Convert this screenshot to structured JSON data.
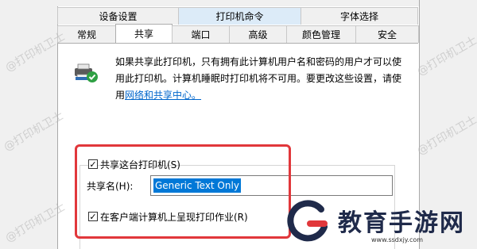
{
  "tabs_row1": [
    "设备设置",
    "打印机命令",
    "字体选择"
  ],
  "tabs_row2": [
    "常规",
    "共享",
    "端口",
    "高级",
    "颜色管理",
    "安全"
  ],
  "active_tab": "共享",
  "description": {
    "line1": "如果共享此打印机，只有拥有此计算机用户名和密码的用户才可以使",
    "line2": "用此打印机。计算机睡眠时打印机将不可用。要更改这些设置，请使",
    "line3_prefix": "用",
    "link": "网络和共享中心。"
  },
  "share_checkbox": {
    "label": "共享这台打印机(S)",
    "checked": true
  },
  "share_name": {
    "label": "共享名(H):",
    "value": "Generic  Text Only"
  },
  "render_jobs_checkbox": {
    "label": "在客户端计算机上呈现打印作业(R)",
    "checked": true
  },
  "watermark": "@打印机卫士",
  "logo": {
    "text": "教育手游网",
    "url": "www.ssdxjy.com"
  },
  "colors": {
    "accent": "#0078d7",
    "highlight_box": "#e1373b",
    "link": "#0066cc"
  }
}
